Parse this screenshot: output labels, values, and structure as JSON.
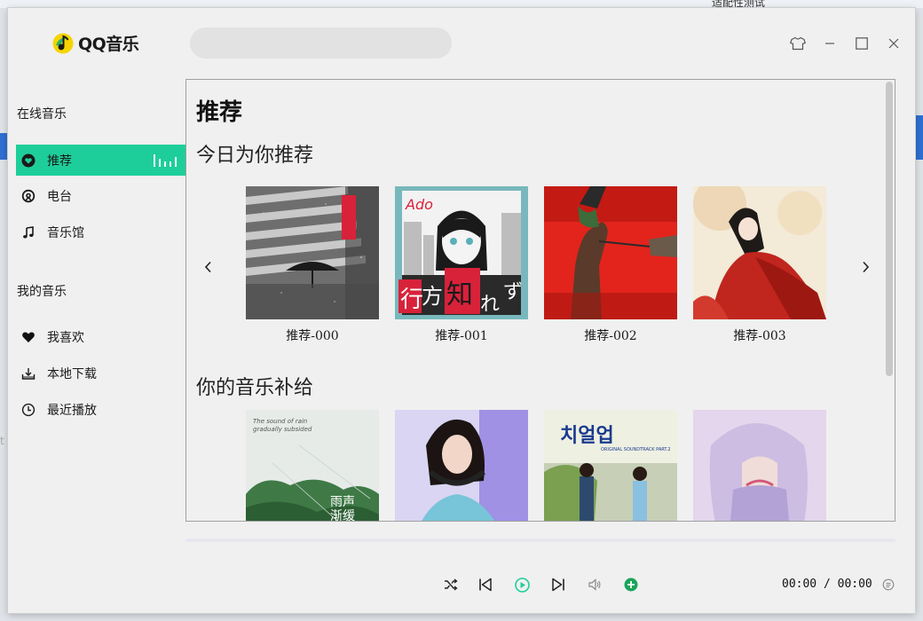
{
  "app": {
    "name": "QQ音乐"
  },
  "background": {
    "left_partial": "t",
    "top_right_text": "适配性测试"
  },
  "search": {
    "placeholder": "",
    "value": ""
  },
  "sidebar": {
    "online_title": "在线音乐",
    "online_items": [
      {
        "label": "推荐",
        "icon": "heart-circle-icon",
        "active": true
      },
      {
        "label": "电台",
        "icon": "radio-icon",
        "active": false
      },
      {
        "label": "音乐馆",
        "icon": "music-note-icon",
        "active": false
      }
    ],
    "my_title": "我的音乐",
    "my_items": [
      {
        "label": "我喜欢",
        "icon": "heart-icon"
      },
      {
        "label": "本地下载",
        "icon": "download-icon"
      },
      {
        "label": "最近播放",
        "icon": "clock-icon"
      }
    ]
  },
  "window_controls": [
    "skin-icon",
    "minimize-icon",
    "maximize-icon",
    "close-icon"
  ],
  "main": {
    "page_title": "推荐",
    "today": {
      "title": "今日为你推荐",
      "cards": [
        {
          "label": "推荐-000"
        },
        {
          "label": "推荐-001"
        },
        {
          "label": "推荐-002"
        },
        {
          "label": "推荐-003"
        }
      ]
    },
    "supply": {
      "title": "你的音乐补给",
      "cards": [
        {
          "label": ""
        },
        {
          "label": ""
        },
        {
          "label": ""
        },
        {
          "label": ""
        }
      ]
    },
    "cover_texts": {
      "ado_logo": "Ado",
      "ado_k1": "行",
      "ado_k2": "方",
      "ado_k3": "知",
      "ado_k4": "れ",
      "ado_k5": "ず",
      "rain_line1": "The sound of rain",
      "rain_line2": "gradually subsided",
      "rain_cn1": "雨声",
      "rain_cn2": "渐缓",
      "kr_title": "치얼업",
      "kr_sub": "ORIGINAL SOUNDTRACK PART.2"
    }
  },
  "player": {
    "time": "00:00 / 00:00",
    "controls": [
      "shuffle-icon",
      "previous-icon",
      "play-icon",
      "next-icon",
      "volume-icon",
      "add-icon",
      "playlist-icon"
    ],
    "accent": "#1ece9a"
  }
}
